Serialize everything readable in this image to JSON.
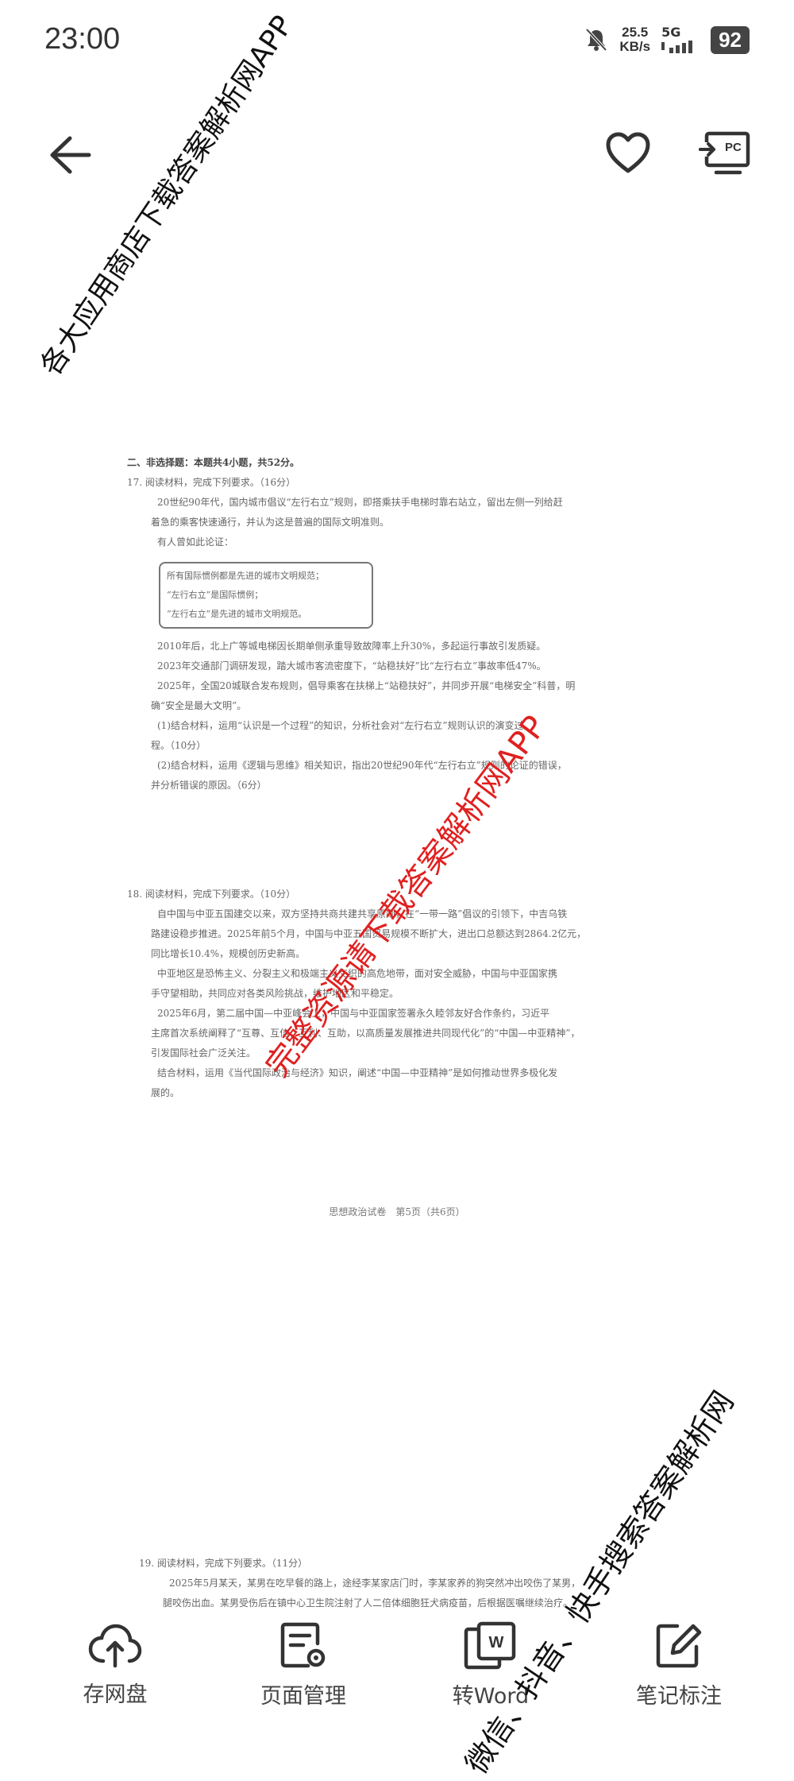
{
  "status_bar": {
    "time": "23:00",
    "net_speed_value": "25.5",
    "net_speed_unit": "KB/s",
    "network": "5G",
    "battery": "92",
    "icons": [
      "bell-muted-icon",
      "signal-icon",
      "battery-icon"
    ]
  },
  "header": {
    "icons": [
      "back-arrow-icon",
      "heart-icon",
      "cast-to-pc-icon"
    ],
    "cast_label": "PC"
  },
  "document": {
    "section_title": "二、非选择题：本题共4小题，共52分。",
    "q17": {
      "title": "17. 阅读材料，完成下列要求。（16分）",
      "p1": "20世纪90年代，国内城市倡议“左行右立”规则，即搭乘扶手电梯时靠右站立，留出左侧一列给赶",
      "p1b": "着急的乘客快速通行，并认为这是普遍的国际文明准则。",
      "p2": "有人曾如此论证：",
      "box": [
        "所有国际惯例都是先进的城市文明规范；",
        "“左行右立”是国际惯例；",
        "“左行右立”是先进的城市文明规范。"
      ],
      "p3": "2010年后，北上广等城电梯因长期单侧承重导致故障率上升30%，多起运行事故引发质疑。",
      "p4": "2023年交通部门调研发现，踏大城市客流密度下，“站稳扶好”比“左行右立”事故率低47%。",
      "p5": "2025年，全国20城联合发布规则，倡导乘客在扶梯上“站稳扶好”，并同步开展“电梯安全”科普，明",
      "p5b": "确“安全是最大文明”。",
      "sub1": "(1)结合材料，运用“认识是一个过程”的知识，分析社会对“左行右立”规则认识的演变过",
      "sub1b": "程。（10分）",
      "sub2": "(2)结合材料，运用《逻辑与思维》相关知识，指出20世纪90年代“左行右立”规则的论证的错误，",
      "sub2b": "并分析错误的原因。（6分）"
    },
    "q18": {
      "title": "18. 阅读材料，完成下列要求。（10分）",
      "p1": "自中国与中亚五国建交以来，双方坚持共商共建共享原则，在“一带一路”倡议的引领下，中吉乌铁",
      "p2": "路建设稳步推进。2025年前5个月，中国与中亚五国贸易规模不断扩大，进出口总额达到2864.2亿元，",
      "p3": "同比增长10.4%，规模创历史新高。",
      "p4": "中亚地区是恐怖主义、分裂主义和极端主义交织的高危地带，面对安全威胁，中国与中亚国家携",
      "p5": "手守望相助，共同应对各类风险挑战，维护地区和平稳定。",
      "p6": "2025年6月，第二届中国—中亚峰会上，中国与中亚国家签署永久睦邻友好合作条约，习近平",
      "p7": "主席首次系统阐释了“互尊、互信、互利、互助，以高质量发展推进共同现代化”的“中国—中亚精神”，",
      "p8": "引发国际社会广泛关注。",
      "p9": "结合材料，运用《当代国际政治与经济》知识，阐述“中国—中亚精神”是如何推动世界多极化发",
      "p9b": "展的。"
    },
    "footer": "思想政治试卷　第5页（共6页）",
    "q19": {
      "title": "19. 阅读材料，完成下列要求。（11分）",
      "p1": "2025年5月某天，某男在吃早餐的路上，途经李某家店门时，李某家养的狗突然冲出咬伤了某男，",
      "p2": "腿咬伤出血。某男受伤后在镇中心卫生院注射了人二倍体细胞狂犬病疫苗，后根据医嘱继续治疗。"
    }
  },
  "watermarks": {
    "top_left": "各大应用商店下载答案解析网APP",
    "center": "完整资源请下载答案解析网APP",
    "bottom_right": "微信、抖音、快手搜索答案解析网"
  },
  "toolbar": {
    "items": [
      {
        "label": "存网盘",
        "icon": "cloud-upload-icon"
      },
      {
        "label": "页面管理",
        "icon": "page-manage-icon"
      },
      {
        "label": "转Word",
        "icon": "convert-word-icon"
      },
      {
        "label": "笔记标注",
        "icon": "edit-note-icon"
      }
    ]
  }
}
